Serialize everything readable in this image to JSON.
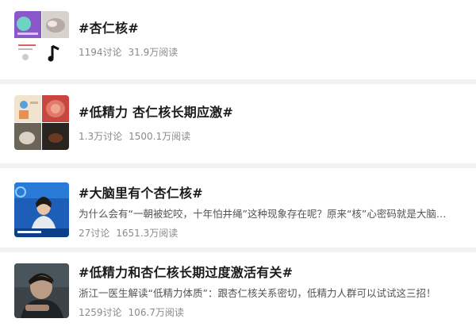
{
  "topics": [
    {
      "title": "#杏仁核#",
      "desc": "",
      "discussions": "1194讨论",
      "reads": "31.9万阅读",
      "thumb_icon": "collage-thumbnail"
    },
    {
      "title": "#低精力 杏仁核长期应激#",
      "desc": "",
      "discussions": "1.3万讨论",
      "reads": "1500.1万阅读",
      "thumb_icon": "collage-thumbnail"
    },
    {
      "title": "#大脑里有个杏仁核#",
      "desc": "为什么会有“一朝被蛇咬，十年怕井绳”这种现象存在呢？原来“核”心密码就是大脑里的...",
      "discussions": "27讨论",
      "reads": "1651.3万阅读",
      "thumb_icon": "tv-presenter-thumbnail"
    },
    {
      "title": "#低精力和杏仁核长期过度激活有关#",
      "desc": "浙江一医生解读“低精力体质”：跟杏仁核关系密切，低精力人群可以试试这三招！",
      "discussions": "1259讨论",
      "reads": "106.7万阅读",
      "thumb_icon": "tired-man-thumbnail"
    }
  ]
}
